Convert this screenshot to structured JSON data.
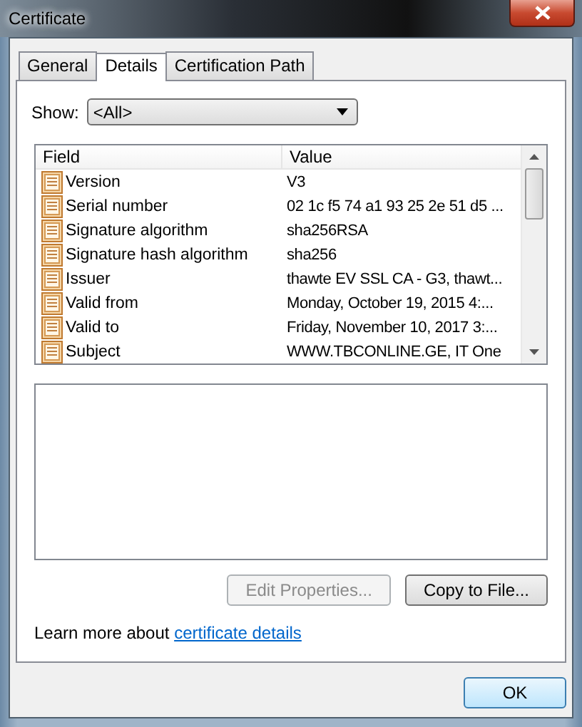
{
  "window": {
    "title": "Certificate"
  },
  "tabs": [
    {
      "label": "General",
      "selected": false
    },
    {
      "label": "Details",
      "selected": true
    },
    {
      "label": "Certification Path",
      "selected": false
    }
  ],
  "show": {
    "label": "Show:",
    "value": "<All>"
  },
  "table": {
    "columns": [
      "Field",
      "Value"
    ],
    "rows": [
      {
        "field": "Version",
        "value": "V3"
      },
      {
        "field": "Serial number",
        "value": "02 1c f5 74 a1 93 25 2e 51 d5 ..."
      },
      {
        "field": "Signature algorithm",
        "value": "sha256RSA"
      },
      {
        "field": "Signature hash algorithm",
        "value": "sha256"
      },
      {
        "field": "Issuer",
        "value": "thawte EV SSL CA - G3, thawt..."
      },
      {
        "field": "Valid from",
        "value": "Monday, October 19, 2015 4:..."
      },
      {
        "field": "Valid to",
        "value": "Friday, November 10, 2017 3:..."
      },
      {
        "field": "Subject",
        "value": "WWW.TBCONLINE.GE, IT One"
      }
    ]
  },
  "buttons": [
    {
      "label": "Edit Properties...",
      "disabled": true
    },
    {
      "label": "Copy to File...",
      "disabled": false
    }
  ],
  "learn_more": {
    "text": "Learn more about ",
    "link": "certificate details"
  },
  "ok_button": {
    "label": "OK"
  }
}
